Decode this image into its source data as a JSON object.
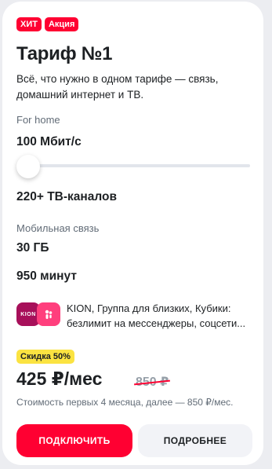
{
  "badges": [
    "ХИТ",
    "Акция"
  ],
  "title": "Тариф №1",
  "description": "Всё, что нужно в одном тарифе — связь, домашний интернет и ТВ.",
  "home": {
    "label": "For home",
    "speed": "100 Мбит/с",
    "tv": "220+ ТВ-каналов"
  },
  "mobile": {
    "label": "Мобильная связь",
    "data": "30 ГБ",
    "minutes": "950 минут"
  },
  "apps": {
    "kion_label": "KION",
    "text": "KION, Группа для близких, Кубики: безлимит на мессенджеры, соцсети..."
  },
  "offer": {
    "discount": "Скидка 50%",
    "price": "425 ₽/мес",
    "old_price": "850 ₽",
    "note": "Стоимость первых 4 месяца, далее — 850 ₽/мес."
  },
  "buttons": {
    "connect": "ПОДКЛЮЧИТЬ",
    "details": "ПОДРОБНЕЕ"
  },
  "slider_level": 0,
  "colors": {
    "brand_red": "#ff0032",
    "discount_yellow": "#fbe341",
    "kion_purple": "#a7105a",
    "group_pink": "#ff3f7d"
  }
}
